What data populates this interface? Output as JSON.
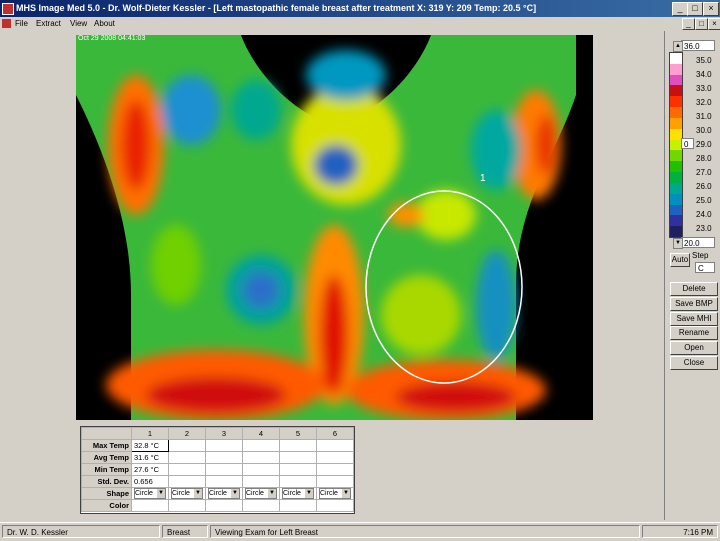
{
  "window": {
    "title": "MHS Image Med 5.0  -  Dr. Wolf-Dieter Kessler - [Left mastopathic female breast after treatment     X: 319  Y: 209    Temp: 20.5 °C]",
    "controls": {
      "minimize": "_",
      "maximize": "□",
      "close": "×"
    }
  },
  "menu": {
    "items": [
      "File",
      "Extract",
      "View",
      "About"
    ]
  },
  "image": {
    "datestamp": "Oct 29 2008 04:41:03",
    "marker_label": "1"
  },
  "scale": {
    "max_value": "36.0",
    "min_value": "20.0",
    "levels": [
      "35.0",
      "34.0",
      "33.0",
      "32.0",
      "31.0",
      "30.0",
      "29.0",
      "28.0",
      "27.0",
      "26.0",
      "25.0",
      "24.0",
      "23.0"
    ],
    "mid_spin": "0",
    "colors": [
      "#ffffff",
      "#ff9fd0",
      "#e04fc0",
      "#c81010",
      "#ff3000",
      "#ff6a00",
      "#ffa000",
      "#ffe000",
      "#c8f000",
      "#70d800",
      "#20c000",
      "#00b040",
      "#00a890",
      "#0090c0",
      "#2060c0",
      "#3030a0",
      "#202060"
    ]
  },
  "auto": {
    "label": "Auto",
    "step_label": "Step",
    "step_value": "C"
  },
  "buttons": {
    "delete": "Delete",
    "save_bmp": "Save BMP",
    "save_mhi": "Save MHI",
    "rename": "Rename",
    "open": "Open",
    "close": "Close"
  },
  "stats": {
    "columns": [
      "1",
      "2",
      "3",
      "4",
      "5",
      "6"
    ],
    "row_labels": [
      "Max Temp",
      "Avg Temp",
      "Min Temp",
      "Std. Dev.",
      "Shape",
      "Color"
    ],
    "col1": {
      "max": "32.8 °C",
      "avg": "31.6 °C",
      "min": "27.6 °C",
      "std": "0.656"
    },
    "shapes": [
      "Circle",
      "Circle",
      "Circle",
      "Circle",
      "Circle",
      "Circle"
    ]
  },
  "status": {
    "user": "Dr. W. D. Kessler",
    "region": "Breast",
    "message": "Viewing Exam for Left Breast",
    "time": "7:16 PM"
  }
}
